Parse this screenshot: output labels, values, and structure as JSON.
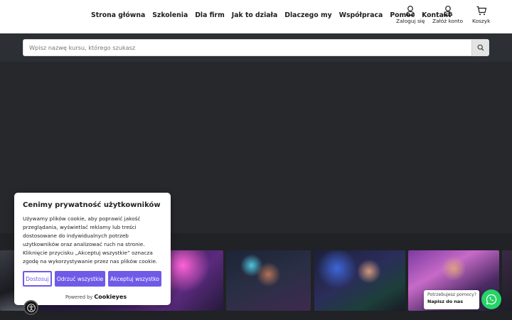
{
  "nav": {
    "items": [
      "Strona główna",
      "Szkolenia",
      "Dla firm",
      "Jak to działa",
      "Dlaczego my",
      "Współpraca",
      "Pomoc",
      "Kontakt"
    ]
  },
  "actions": {
    "login": "Zaloguj się",
    "register": "Załóż konto",
    "cart": "Koszyk"
  },
  "search": {
    "placeholder": "Wpisz nazwę kursu, którego szukasz"
  },
  "cookie": {
    "title": "Cenimy prywatność użytkowników",
    "body": "Używamy plików cookie, aby poprawić jakość przeglądania, wyświetlać reklamy lub treści dostosowane do indywidualnych potrzeb użytkowników oraz analizować ruch na stronie. Kliknięcie przycisku „Akceptuj wszystkie” oznacza zgodę na wykorzystywanie przez nas plików cookie.",
    "customize": "Dostosuj",
    "reject": "Odrzuć wszystkie",
    "accept": "Akceptuj wszystko",
    "powered_by": "Powered by",
    "brand": "Cookieyes"
  },
  "whatsapp": {
    "question": "Potrzebujesz pomocy?",
    "cta": "Napisz do nas"
  },
  "colors": {
    "accent": "#6f5ae8",
    "whatsapp": "#25d366",
    "dark_bg": "#26282b"
  }
}
